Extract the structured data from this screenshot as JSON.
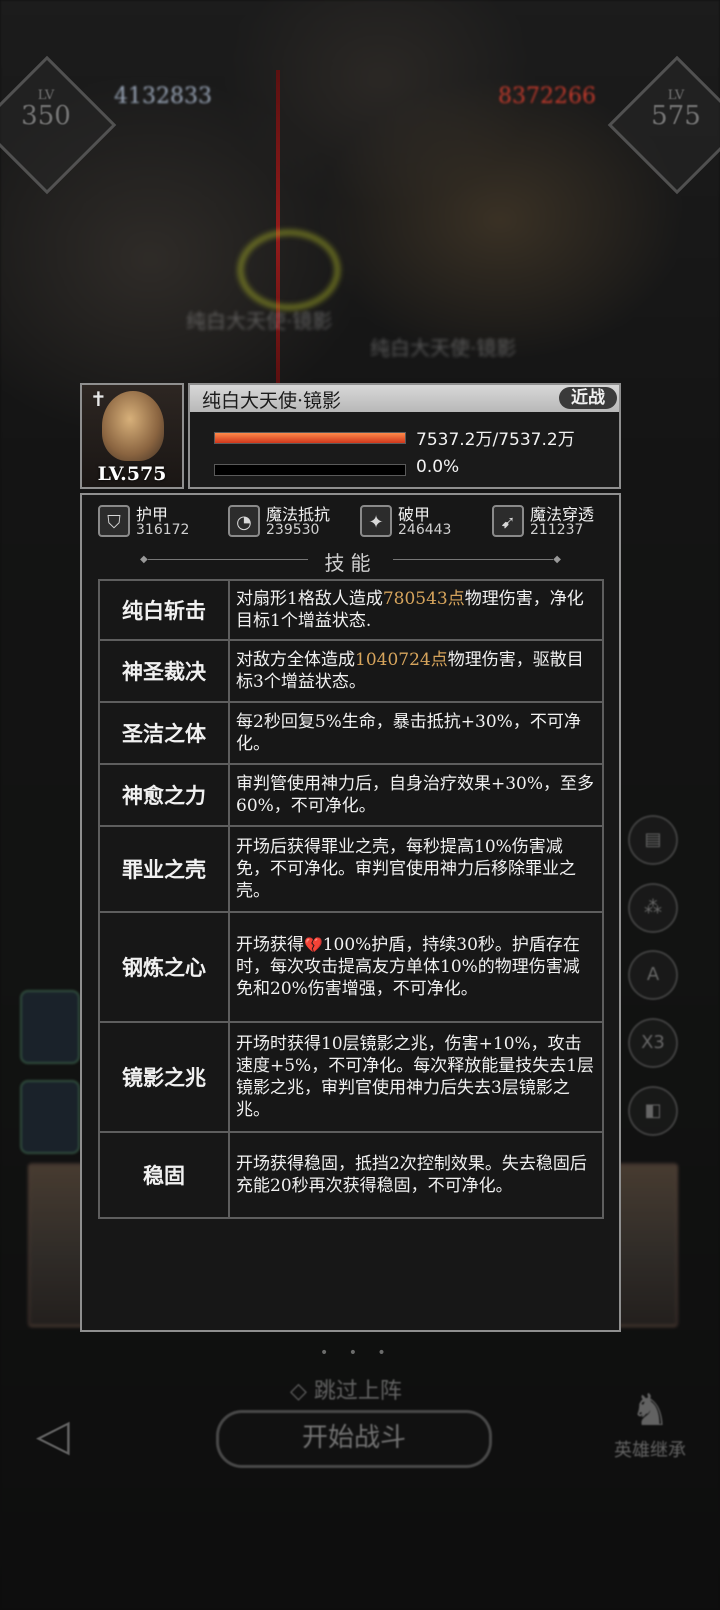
{
  "battle": {
    "left_level": "350",
    "left_power": "4132833",
    "right_level": "575",
    "right_power": "8372266",
    "float_texts": [
      "纯白大天使·镜影",
      "纯白大天使·镜影"
    ],
    "side_buttons": [
      "▤",
      "⁂",
      "A",
      "X3",
      "◧"
    ],
    "skip_label": "跳过上阵",
    "start_label": "开始战斗",
    "inherit_label": "英雄继承",
    "colors": {
      "power_left": "#9aa6b8",
      "power_right": "#c0392b"
    }
  },
  "unit": {
    "name": "纯白大天使·镜影",
    "type_tag": "近战",
    "level": "LV.575",
    "hp_text": "7537.2万/7537.2万",
    "hp_fraction": 1.0,
    "energy_text": "0.0%",
    "energy_fraction": 0.0
  },
  "stats": [
    {
      "icon": "armor-icon",
      "label": "护甲",
      "value": "316172"
    },
    {
      "icon": "magic-resist-icon",
      "label": "魔法抵抗",
      "value": "239530"
    },
    {
      "icon": "armor-break-icon",
      "label": "破甲",
      "value": "246443"
    },
    {
      "icon": "magic-penetration-icon",
      "label": "魔法穿透",
      "value": "211237"
    }
  ],
  "skills_title": "技能",
  "skills": [
    {
      "name": "纯白斩击",
      "pre": "对扇形1格敌人造成",
      "hl": "780543点",
      "post": "物理伤害，净化目标1个增益状态."
    },
    {
      "name": "神圣裁决",
      "pre": "对敌方全体造成",
      "hl": "1040724点",
      "post": "物理伤害，驱散目标3个增益状态。"
    },
    {
      "name": "圣洁之体",
      "desc": "每2秒回复5%生命，暴击抵抗+30%，不可净化。"
    },
    {
      "name": "神愈之力",
      "desc": "审判管使用神力后，自身治疗效果+30%，至多60%，不可净化。"
    },
    {
      "name": "罪业之壳",
      "desc": "开场后获得罪业之壳，每秒提高10%伤害减免，不可净化。审判官使用神力后移除罪业之壳。"
    },
    {
      "name": "钢炼之心",
      "pre": "开场获得",
      "post": "100%护盾，持续30秒。护盾存在时，每次攻击提高友方单体10%的物理伤害减免和20%伤害增强，不可净化。"
    },
    {
      "name": "镜影之兆",
      "desc": "开场时获得10层镜影之兆，伤害+10%，攻击速度+5%，不可净化。每次释放能量技失去1层镜影之兆，审判官使用神力后失去3层镜影之兆。"
    },
    {
      "name": "稳固",
      "desc": "开场获得稳固，抵挡2次控制效果。失去稳固后充能20秒再次获得稳固，不可净化。"
    }
  ],
  "colors": {
    "highlight": "#d6a45c",
    "hp_bar": "#e0462a",
    "panel_border": "#8f8f8f"
  }
}
